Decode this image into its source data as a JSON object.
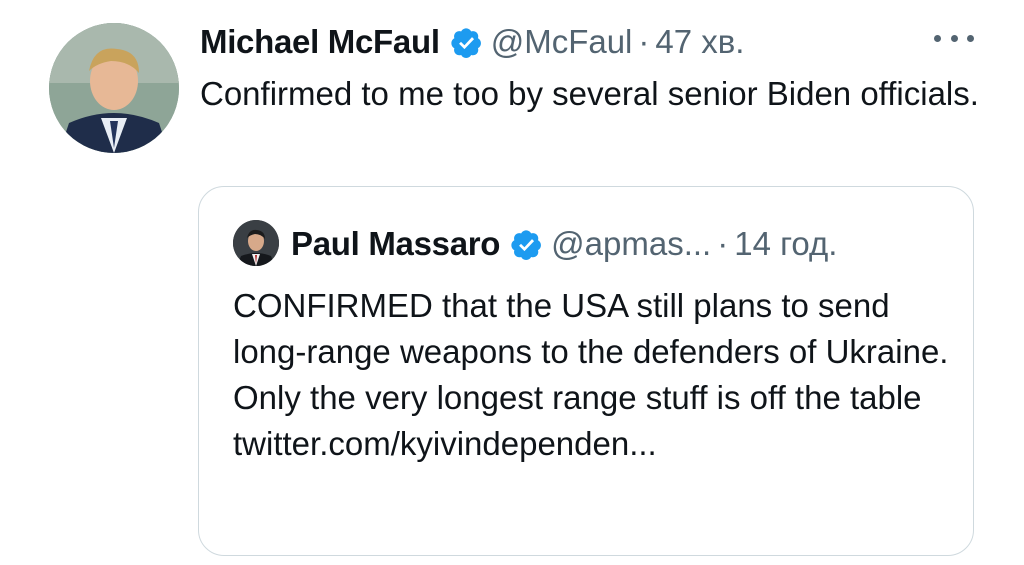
{
  "tweet": {
    "author_name": "Michael McFaul",
    "author_handle": "@McFaul",
    "separator": "·",
    "time": "47 хв.",
    "text": "Confirmed to me too by several senior Biden officials.",
    "verified_icon": "verified-badge-icon",
    "more_icon": "more-options-icon"
  },
  "quote": {
    "author_name": "Paul Massaro",
    "author_handle": "@apmas...",
    "separator": "·",
    "time": "14 год.",
    "text": "CONFIRMED that the USA still plans to send long-range weapons to the defenders of Ukraine. Only the very longest range stuff is off the table twitter.com/kyivindependen..."
  },
  "colors": {
    "text": "#0f1419",
    "secondary": "#536471",
    "verified": "#1d9bf0",
    "border": "#cfd9de"
  }
}
